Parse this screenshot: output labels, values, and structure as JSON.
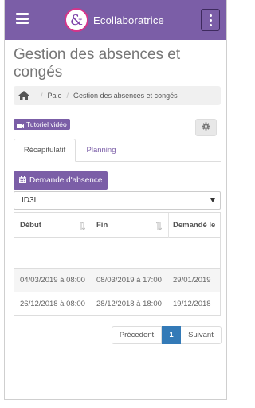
{
  "header": {
    "brand_name": "Ecollaboratrice",
    "logo_glyph": "&",
    "accent_color": "#7b5ea7",
    "icons": [
      "menu-icon",
      "more-vertical-icon"
    ]
  },
  "page": {
    "title": "Gestion des absences et congés"
  },
  "breadcrumb": {
    "items": [
      "Paie",
      "Gestion des absences et congés"
    ],
    "separator": "/"
  },
  "toolbar": {
    "tutorial_label": "Tutoriel vidéo"
  },
  "tabs": [
    {
      "label": "Récapitulatif",
      "active": true
    },
    {
      "label": "Planning",
      "active": false
    }
  ],
  "actions": {
    "new_request_label": "Demande d'absence"
  },
  "filter": {
    "selected": "ID3I"
  },
  "table": {
    "columns": [
      "Début",
      "Fin",
      "Demandé le"
    ],
    "rows": [
      [
        "04/03/2019 à 08:00",
        "08/03/2019 à 17:00",
        "29/01/2019"
      ],
      [
        "26/12/2018 à 08:00",
        "28/12/2018 à 18:00",
        "19/12/2018"
      ]
    ]
  },
  "pagination": {
    "prev_label": "Précedent",
    "current": "1",
    "next_label": "Suivant"
  }
}
